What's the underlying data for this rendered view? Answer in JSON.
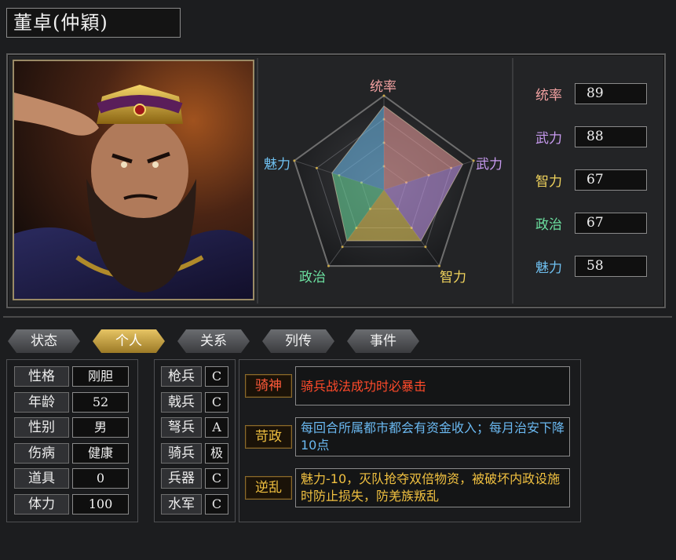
{
  "general": {
    "name": "董卓",
    "style_name": "(仲穎)",
    "title": "董卓(仲穎)"
  },
  "radar": {
    "labels": {
      "leadership": "统率",
      "war": "武力",
      "intelligence": "智力",
      "politics": "政治",
      "charm": "魅力"
    },
    "max": 100
  },
  "stats": [
    {
      "label": "统率",
      "value": "89",
      "color": "#f0a0a0"
    },
    {
      "label": "武力",
      "value": "88",
      "color": "#c89bf0"
    },
    {
      "label": "智力",
      "value": "67",
      "color": "#f0d35c"
    },
    {
      "label": "政治",
      "value": "67",
      "color": "#6ce0a0"
    },
    {
      "label": "魅力",
      "value": "58",
      "color": "#6fc0f0"
    }
  ],
  "tabs": [
    {
      "label": "状态",
      "active": false
    },
    {
      "label": "个人",
      "active": true
    },
    {
      "label": "关系",
      "active": false
    },
    {
      "label": "列传",
      "active": false
    },
    {
      "label": "事件",
      "active": false
    }
  ],
  "personal": [
    {
      "key": "性格",
      "value": "刚胆"
    },
    {
      "key": "年龄",
      "value": "52"
    },
    {
      "key": "性别",
      "value": "男"
    },
    {
      "key": "伤病",
      "value": "健康"
    },
    {
      "key": "道具",
      "value": "0"
    },
    {
      "key": "体力",
      "value": "100"
    }
  ],
  "troops": [
    {
      "key": "枪兵",
      "value": "C"
    },
    {
      "key": "戟兵",
      "value": "C"
    },
    {
      "key": "弩兵",
      "value": "A"
    },
    {
      "key": "骑兵",
      "value": "极"
    },
    {
      "key": "兵器",
      "value": "C"
    },
    {
      "key": "水军",
      "value": "C"
    }
  ],
  "skills": [
    {
      "name": "骑神",
      "desc": "骑兵战法成功时必暴击",
      "name_color": "#ff5a3a",
      "desc_color": "#ff4a2a"
    },
    {
      "name": "苛政",
      "desc": "每回合所属都市都会有资金收入；每月治安下降10点",
      "name_color": "#f0c040",
      "desc_color": "#6ab8f0"
    },
    {
      "name": "逆乱",
      "desc": "魅力-10，灭队抢夺双倍物资，被破坏内政设施时防止损失，防羌族叛乱",
      "name_color": "#f0c040",
      "desc_color": "#f0c040"
    }
  ]
}
